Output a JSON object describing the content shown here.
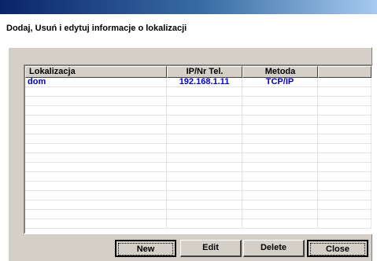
{
  "dialog": {
    "subtitle": "Dodaj, Usuń i edytuj informacje o lokalizacji"
  },
  "list": {
    "columns": [
      "Lokalizacja",
      "IP/Nr Tel.",
      "Metoda",
      ""
    ],
    "rows": [
      {
        "location": "dom",
        "address": "192.168.1.11",
        "method": "TCP/IP"
      }
    ]
  },
  "buttons": {
    "new": "New",
    "edit": "Edit",
    "delete": "Delete",
    "close": "Close"
  },
  "colors": {
    "title_gradient_start": "#0a246a",
    "row_text": "#0000cc",
    "face": "#d4d0c8"
  }
}
